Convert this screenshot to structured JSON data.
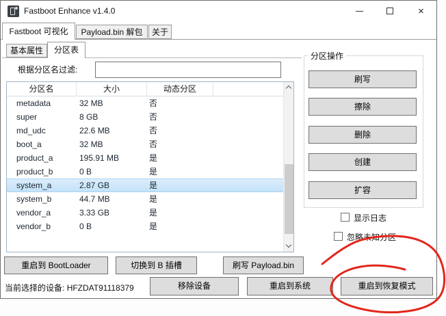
{
  "window": {
    "title": "Fastboot Enhance v1.4.0",
    "controls": {
      "minimize": "minimize",
      "maximize": "maximize",
      "close": "×"
    }
  },
  "main_tabs": [
    {
      "label": "Fastboot 可视化",
      "active": true
    },
    {
      "label": "Payload.bin 解包",
      "active": false
    },
    {
      "label": "关于",
      "active": false
    }
  ],
  "sub_tabs": [
    {
      "label": "基本属性",
      "active": false
    },
    {
      "label": "分区表",
      "active": true
    }
  ],
  "filter": {
    "label": "根据分区名过滤:",
    "value": ""
  },
  "partition_table": {
    "columns": [
      "分区名",
      "大小",
      "动态分区",
      ""
    ],
    "selected": "system_a",
    "rows": [
      {
        "name": "metadata",
        "size": "32 MB",
        "dynamic": "否"
      },
      {
        "name": "super",
        "size": "8 GB",
        "dynamic": "否"
      },
      {
        "name": "md_udc",
        "size": "22.6 MB",
        "dynamic": "否"
      },
      {
        "name": "boot_a",
        "size": "32 MB",
        "dynamic": "否"
      },
      {
        "name": "product_a",
        "size": "195.91 MB",
        "dynamic": "是"
      },
      {
        "name": "product_b",
        "size": "0 B",
        "dynamic": "是"
      },
      {
        "name": "system_a",
        "size": "2.87 GB",
        "dynamic": "是"
      },
      {
        "name": "system_b",
        "size": "44.7 MB",
        "dynamic": "是"
      },
      {
        "name": "vendor_a",
        "size": "3.33 GB",
        "dynamic": "是"
      },
      {
        "name": "vendor_b",
        "size": "0 B",
        "dynamic": "是"
      }
    ]
  },
  "partition_ops": {
    "title": "分区操作",
    "buttons": [
      "刷写",
      "擦除",
      "删除",
      "创建",
      "扩容"
    ]
  },
  "checkboxes": [
    {
      "label": "显示日志",
      "checked": false
    },
    {
      "label": "忽略未知分区",
      "checked": false
    }
  ],
  "actions_row1": [
    "重启到 BootLoader",
    "切换到 B 插槽",
    "刷写 Payload.bin"
  ],
  "status": {
    "label": "当前选择的设备:",
    "device_id": "HFZDAT91118379"
  },
  "actions_row2": [
    "移除设备",
    "重启到系统",
    "重启到恢复模式"
  ],
  "annotation": {
    "type": "hand-drawn-circle",
    "target": "重启到恢复模式",
    "color": "#e3261b"
  },
  "colors": {
    "selection_bg": "#c3e2f8",
    "button_bg": "#dddddd",
    "button_border": "#707070",
    "table_border": "#9db5cc",
    "annotation_red": "#e3261b"
  }
}
